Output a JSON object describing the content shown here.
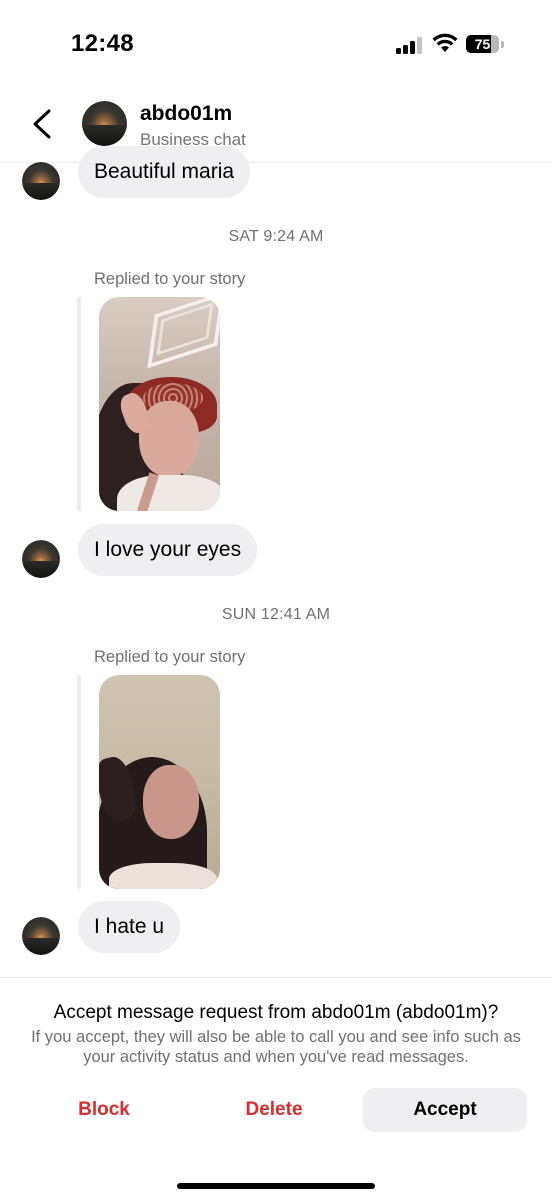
{
  "status_bar": {
    "time": "12:48",
    "battery_level": "75",
    "signal_bars_active": 3,
    "signal_bars_total": 4
  },
  "header": {
    "back_icon": "chevron-left-icon",
    "username": "abdo01m",
    "subtitle": "Business chat"
  },
  "messages": [
    {
      "type": "text",
      "text": "Beautiful maria"
    },
    {
      "type": "timestamp",
      "text": "SAT 9:24 AM"
    },
    {
      "type": "story_reply",
      "label": "Replied to your story"
    },
    {
      "type": "text",
      "text": "I love your eyes"
    },
    {
      "type": "timestamp",
      "text": "SUN 12:41 AM"
    },
    {
      "type": "story_reply",
      "label": "Replied to your story"
    },
    {
      "type": "text",
      "text": "I hate u"
    }
  ],
  "request": {
    "title": "Accept message request from abdo01m (abdo01m)?",
    "description": "If you accept, they will also be able to call you and see info such as your activity status and when you've read messages.",
    "block_label": "Block",
    "delete_label": "Delete",
    "accept_label": "Accept"
  },
  "colors": {
    "destructive": "#d92d2d",
    "bubble_bg": "#efeff2",
    "secondary_text": "#707070"
  }
}
